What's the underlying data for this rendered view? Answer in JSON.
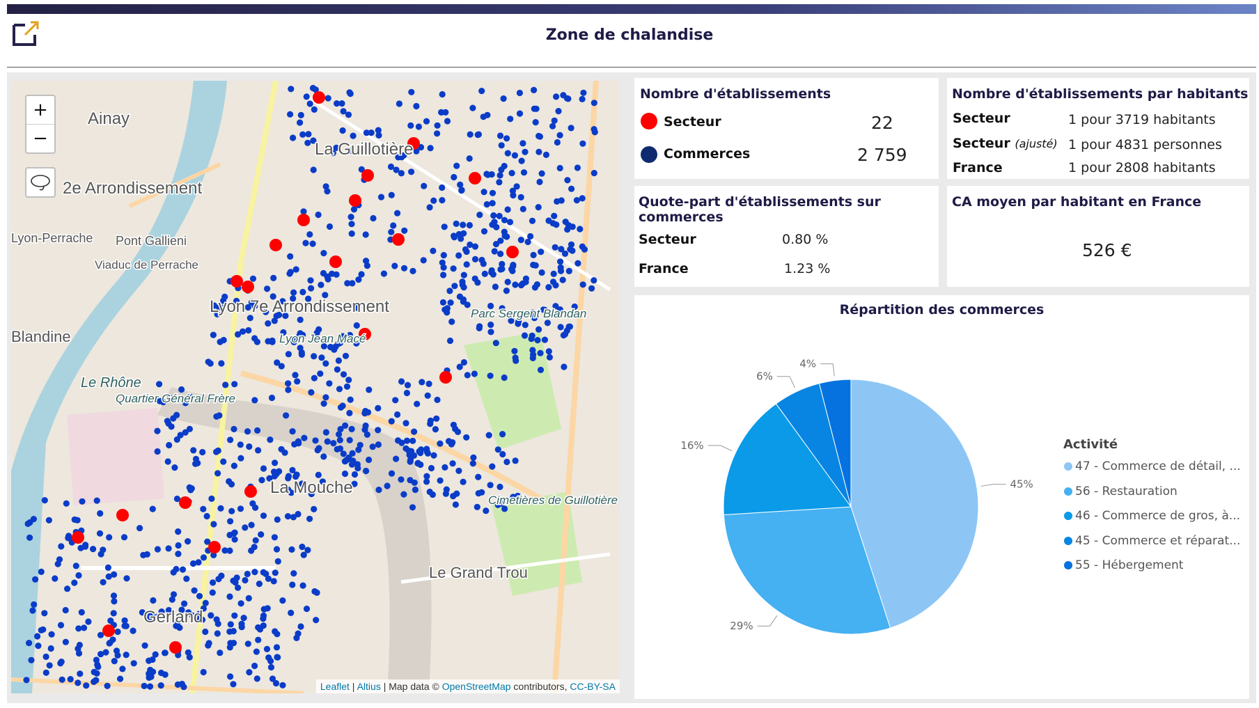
{
  "header": {
    "title": "Zone de chalandise"
  },
  "map": {
    "labels": [
      "Ainay",
      "2e Arrondissement",
      "Lyon-Perrache",
      "Pont Gallieni",
      "Viaduc de Perrache",
      "Lyon 7e Arrondissement",
      "La Guillotière",
      "Parc Sergent Blandan",
      "Lyon Jean Macé",
      "Quartier Général Frère",
      "La Mouche",
      "Cimetières de Guillotière",
      "Le Grand Trou",
      "Gerland",
      "Le Rhône",
      "Blandine"
    ],
    "attribution": {
      "leaflet": "Leaflet",
      "sep1": " | ",
      "altius": "Altius",
      "sep2": " | Map data © ",
      "osm": "OpenStreetMap",
      "contrib": " contributors, ",
      "license": "CC-BY-SA"
    },
    "zoom_in": "+",
    "zoom_out": "−",
    "colors": {
      "secteur": "#ff0000",
      "commerces": "#0a3cc8"
    }
  },
  "etablissements": {
    "title": "Nombre d'établissements",
    "rows": [
      {
        "label": "Secteur",
        "value": "22",
        "color": "#ff0000"
      },
      {
        "label": "Commerces",
        "value": "2 759",
        "color": "#0f2a6e"
      }
    ]
  },
  "par_habitants": {
    "title": "Nombre d'établissements par habitants",
    "rows": [
      {
        "label": "Secteur",
        "note": "",
        "value": "1 pour 3719 habitants"
      },
      {
        "label": "Secteur",
        "note": "(ajusté)",
        "value": "1 pour 4831 personnes"
      },
      {
        "label": "France",
        "note": "",
        "value": "1 pour 2808 habitants"
      }
    ]
  },
  "quote_part": {
    "title": "Quote-part d'établissements sur commerces",
    "rows": [
      {
        "label": "Secteur",
        "value": "0.80 %"
      },
      {
        "label": "France",
        "value": "1.23 %"
      }
    ]
  },
  "ca_moyen": {
    "title": "CA moyen par habitant en France",
    "value": "526 €"
  },
  "chart_data": {
    "type": "pie",
    "title": "Répartition des commerces",
    "legend_title": "Activité",
    "legend_position": "right",
    "slices": [
      {
        "label": "47 - Commerce de détail, ...",
        "value": 45,
        "display": "45%",
        "color": "#8dc6f5"
      },
      {
        "label": "56 - Restauration",
        "value": 29,
        "display": "29%",
        "color": "#45b0f2"
      },
      {
        "label": "46 - Commerce de gros, à...",
        "value": 16,
        "display": "16%",
        "color": "#0a9ae8"
      },
      {
        "label": "45 - Commerce et réparat...",
        "value": 6,
        "display": "6%",
        "color": "#0885e2"
      },
      {
        "label": "55 - Hébergement",
        "value": 4,
        "display": "4%",
        "color": "#0572e0"
      }
    ]
  }
}
